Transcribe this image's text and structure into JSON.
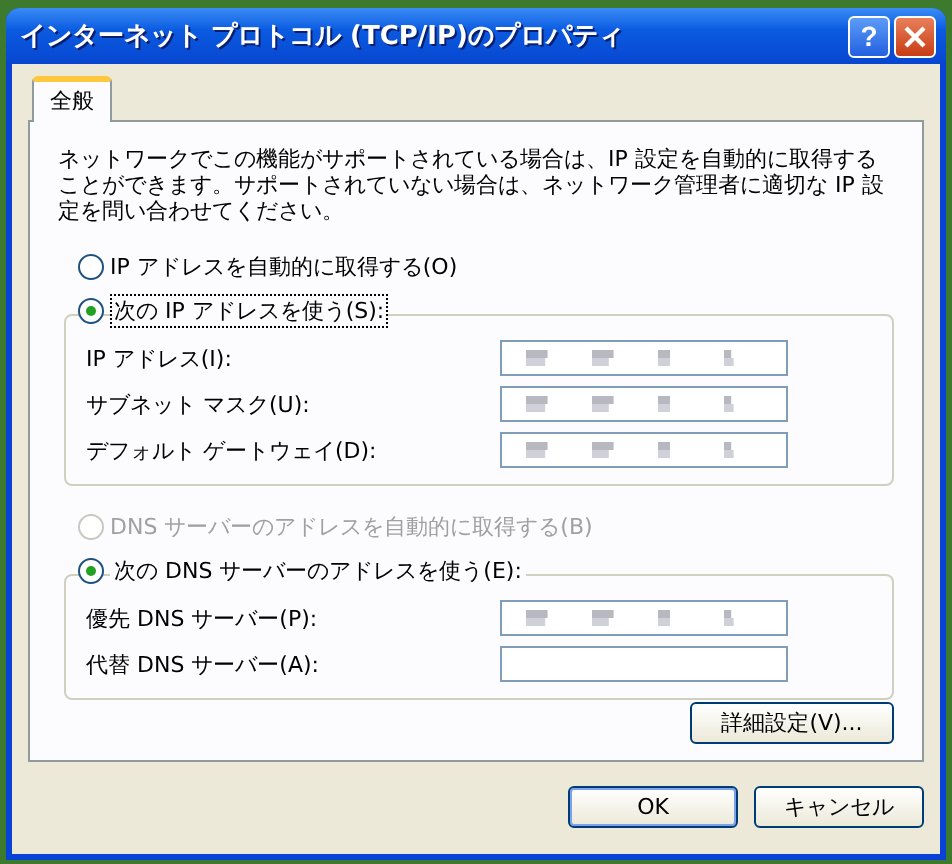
{
  "window": {
    "title": "インターネット プロトコル (TCP/IP)のプロパティ",
    "help_button": "?"
  },
  "tabs": [
    {
      "label": "全般",
      "selected": true
    }
  ],
  "description": "ネットワークでこの機能がサポートされている場合は、IP 設定を自動的に取得することができます。サポートされていない場合は、ネットワーク管理者に適切な IP 設定を問い合わせてください。",
  "sections": [
    {
      "auto_option": {
        "label": "IP アドレスを自動的に取得する(O)",
        "selected": false,
        "disabled": false
      },
      "manual_option": {
        "label": "次の IP アドレスを使う(S):",
        "selected": true,
        "focused": true
      },
      "fields": [
        {
          "label": "IP アドレス(I):",
          "value_obscured": true
        },
        {
          "label": "サブネット マスク(U):",
          "value_obscured": true
        },
        {
          "label": "デフォルト ゲートウェイ(D):",
          "value_obscured": true
        }
      ]
    },
    {
      "auto_option": {
        "label": "DNS サーバーのアドレスを自動的に取得する(B)",
        "selected": false,
        "disabled": true
      },
      "manual_option": {
        "label": "次の DNS サーバーのアドレスを使う(E):",
        "selected": true,
        "focused": false
      },
      "fields": [
        {
          "label": "優先 DNS サーバー(P):",
          "value_obscured": true
        },
        {
          "label": "代替 DNS サーバー(A):",
          "value_obscured": false
        }
      ]
    }
  ],
  "advanced_button": "詳細設定(V)...",
  "buttons": [
    {
      "label": "OK",
      "default": true
    },
    {
      "label": "キャンセル",
      "default": false
    }
  ]
}
